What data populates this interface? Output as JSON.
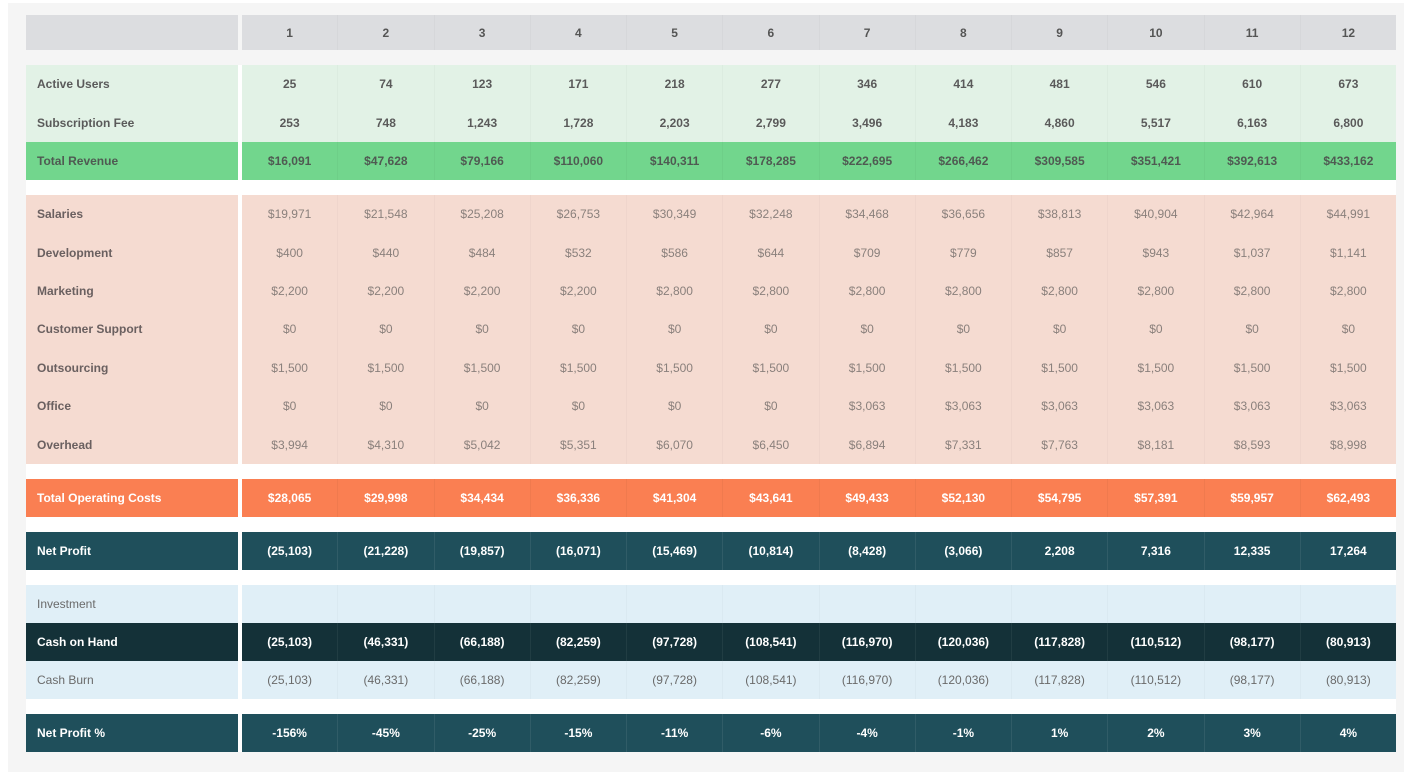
{
  "columns": [
    "1",
    "2",
    "3",
    "4",
    "5",
    "6",
    "7",
    "8",
    "9",
    "10",
    "11",
    "12"
  ],
  "revenue": {
    "active_users": {
      "label": "Active Users",
      "values": [
        "25",
        "74",
        "123",
        "171",
        "218",
        "277",
        "346",
        "414",
        "481",
        "546",
        "610",
        "673"
      ]
    },
    "subscription_fee": {
      "label": "Subscription Fee",
      "values": [
        "253",
        "748",
        "1,243",
        "1,728",
        "2,203",
        "2,799",
        "3,496",
        "4,183",
        "4,860",
        "5,517",
        "6,163",
        "6,800"
      ]
    },
    "total_revenue": {
      "label": "Total Revenue",
      "values": [
        "$16,091",
        "$47,628",
        "$79,166",
        "$110,060",
        "$140,311",
        "$178,285",
        "$222,695",
        "$266,462",
        "$309,585",
        "$351,421",
        "$392,613",
        "$433,162"
      ]
    }
  },
  "expenses": [
    {
      "label": "Salaries",
      "values": [
        "$19,971",
        "$21,548",
        "$25,208",
        "$26,753",
        "$30,349",
        "$32,248",
        "$34,468",
        "$36,656",
        "$38,813",
        "$40,904",
        "$42,964",
        "$44,991"
      ]
    },
    {
      "label": "Development",
      "values": [
        "$400",
        "$440",
        "$484",
        "$532",
        "$586",
        "$644",
        "$709",
        "$779",
        "$857",
        "$943",
        "$1,037",
        "$1,141"
      ]
    },
    {
      "label": "Marketing",
      "values": [
        "$2,200",
        "$2,200",
        "$2,200",
        "$2,200",
        "$2,800",
        "$2,800",
        "$2,800",
        "$2,800",
        "$2,800",
        "$2,800",
        "$2,800",
        "$2,800"
      ]
    },
    {
      "label": "Customer Support",
      "values": [
        "$0",
        "$0",
        "$0",
        "$0",
        "$0",
        "$0",
        "$0",
        "$0",
        "$0",
        "$0",
        "$0",
        "$0"
      ]
    },
    {
      "label": "Outsourcing",
      "values": [
        "$1,500",
        "$1,500",
        "$1,500",
        "$1,500",
        "$1,500",
        "$1,500",
        "$1,500",
        "$1,500",
        "$1,500",
        "$1,500",
        "$1,500",
        "$1,500"
      ]
    },
    {
      "label": "Office",
      "values": [
        "$0",
        "$0",
        "$0",
        "$0",
        "$0",
        "$0",
        "$3,063",
        "$3,063",
        "$3,063",
        "$3,063",
        "$3,063",
        "$3,063"
      ]
    },
    {
      "label": "Overhead",
      "values": [
        "$3,994",
        "$4,310",
        "$5,042",
        "$5,351",
        "$6,070",
        "$6,450",
        "$6,894",
        "$7,331",
        "$7,763",
        "$8,181",
        "$8,593",
        "$8,998"
      ]
    }
  ],
  "total_operating_costs": {
    "label": "Total Operating Costs",
    "values": [
      "$28,065",
      "$29,998",
      "$34,434",
      "$36,336",
      "$41,304",
      "$43,641",
      "$49,433",
      "$52,130",
      "$54,795",
      "$57,391",
      "$59,957",
      "$62,493"
    ]
  },
  "net_profit": {
    "label": "Net Profit",
    "values": [
      "(25,103)",
      "(21,228)",
      "(19,857)",
      "(16,071)",
      "(15,469)",
      "(10,814)",
      "(8,428)",
      "(3,066)",
      "2,208",
      "7,316",
      "12,335",
      "17,264"
    ]
  },
  "investment": {
    "label": "Investment",
    "values": [
      "",
      "",
      "",
      "",
      "",
      "",
      "",
      "",
      "",
      "",
      "",
      ""
    ]
  },
  "cash_on_hand": {
    "label": "Cash on Hand",
    "values": [
      "(25,103)",
      "(46,331)",
      "(66,188)",
      "(82,259)",
      "(97,728)",
      "(108,541)",
      "(116,970)",
      "(120,036)",
      "(117,828)",
      "(110,512)",
      "(98,177)",
      "(80,913)"
    ]
  },
  "cash_burn": {
    "label": "Cash Burn",
    "values": [
      "(25,103)",
      "(46,331)",
      "(66,188)",
      "(82,259)",
      "(97,728)",
      "(108,541)",
      "(116,970)",
      "(120,036)",
      "(117,828)",
      "(110,512)",
      "(98,177)",
      "(80,913)"
    ]
  },
  "net_profit_pct": {
    "label": "Net Profit %",
    "values": [
      "-156%",
      "-45%",
      "-25%",
      "-15%",
      "-11%",
      "-6%",
      "-4%",
      "-1%",
      "1%",
      "2%",
      "3%",
      "4%"
    ]
  },
  "colors": {
    "header": "#dcdde0",
    "revenue_bg": "#e2f2e6",
    "total_revenue": "#72d68d",
    "expense_bg": "#f5dbd1",
    "total_operating_costs": "#fa7f52",
    "net_profit": "#1f4f5b",
    "investment_bg": "#e0eff7",
    "cash_on_hand": "#143138"
  }
}
